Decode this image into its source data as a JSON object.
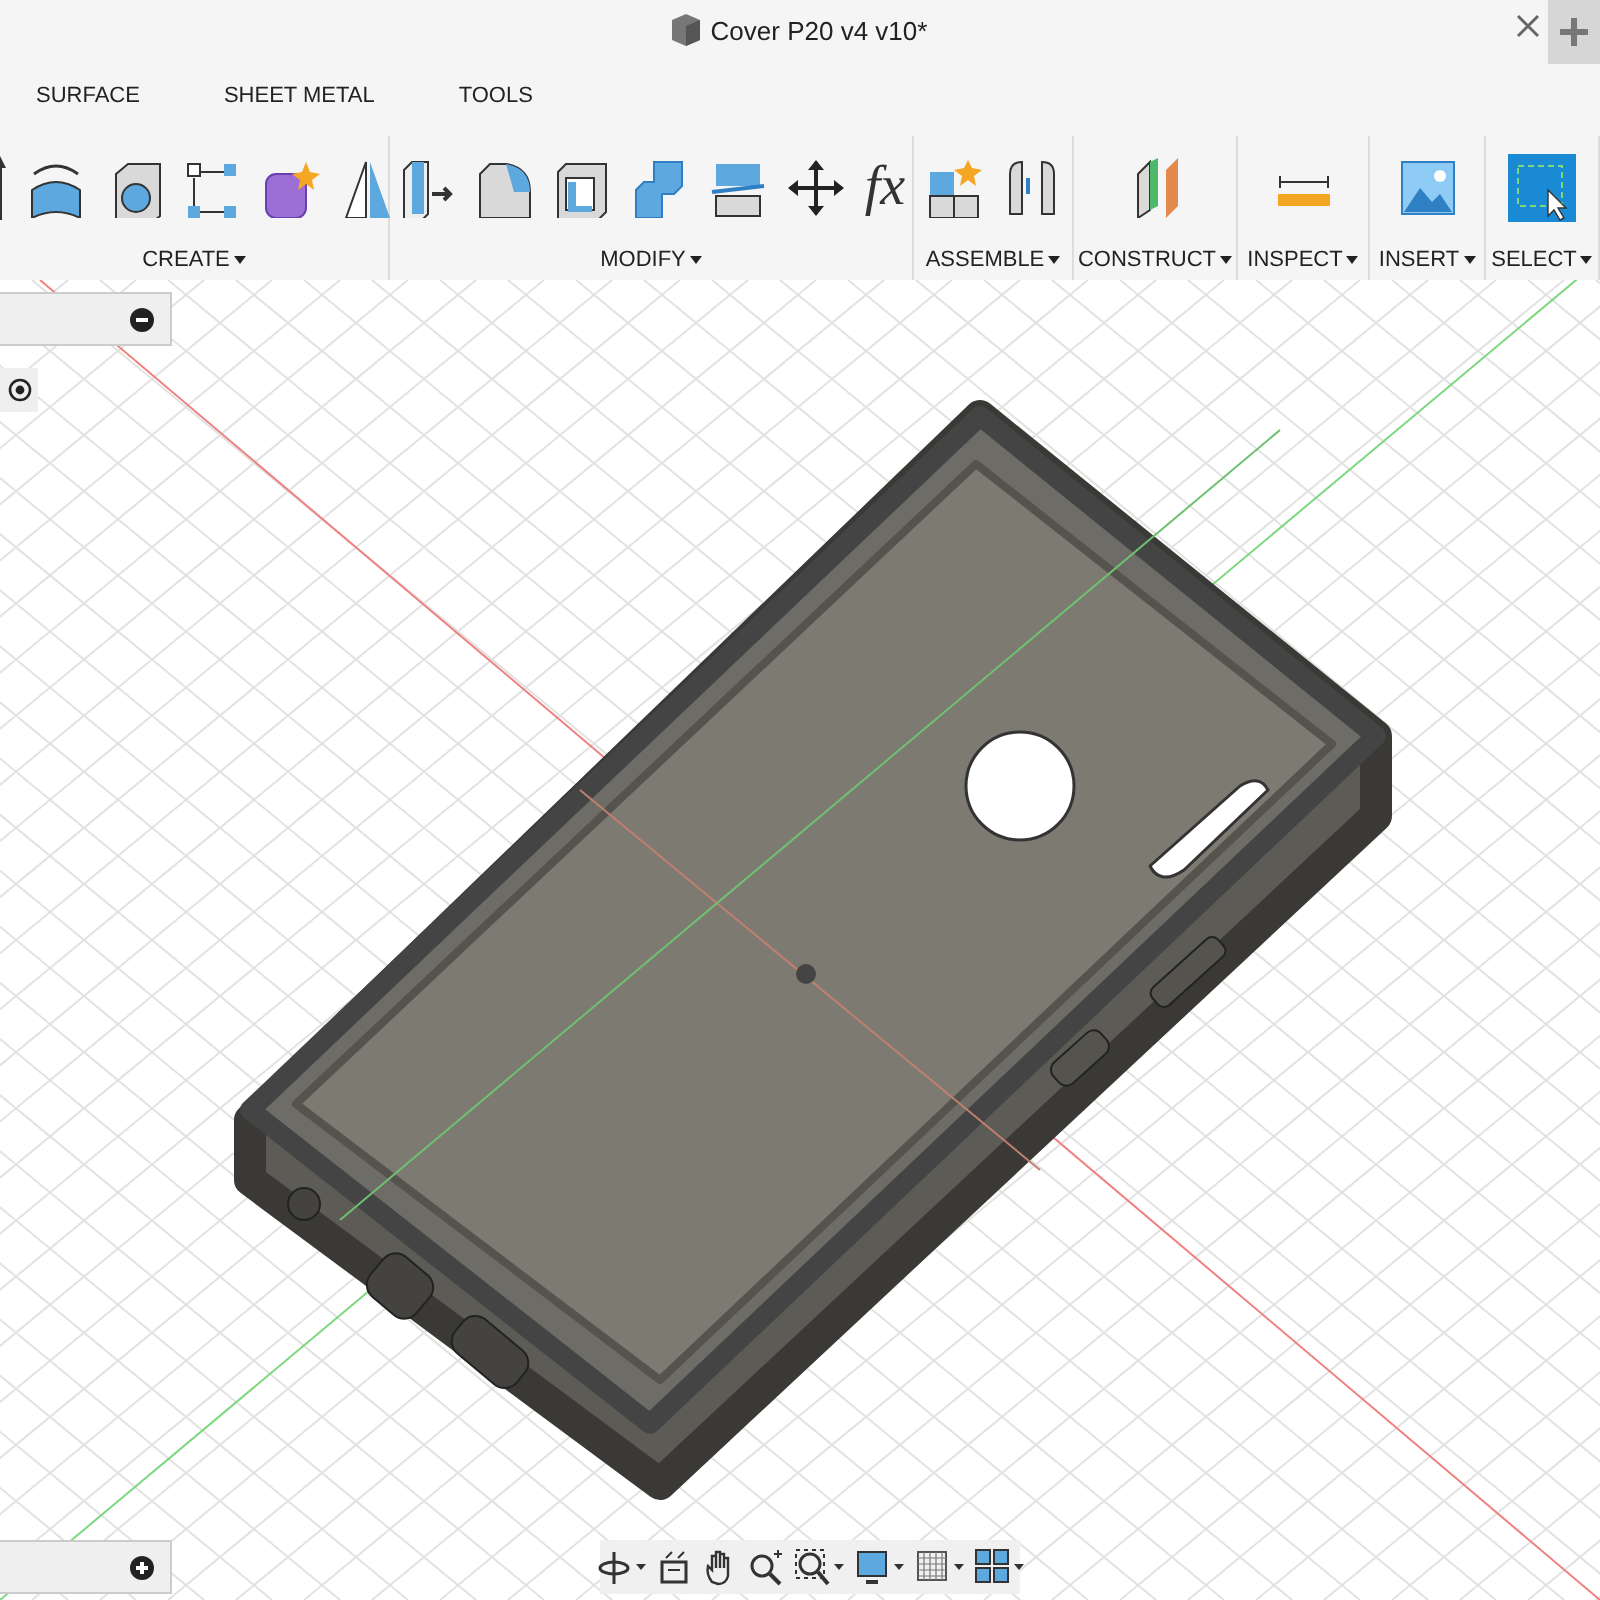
{
  "window": {
    "title": "Cover P20 v4 v10*"
  },
  "tabs": [
    {
      "label": "SURFACE",
      "selected": false
    },
    {
      "label": "SHEET METAL",
      "selected": false
    },
    {
      "label": "TOOLS",
      "selected": false
    }
  ],
  "toolbar_groups": [
    {
      "label": "CREATE"
    },
    {
      "label": "MODIFY",
      "symbol": "fx"
    },
    {
      "label": "ASSEMBLE"
    },
    {
      "label": "CONSTRUCT"
    },
    {
      "label": "INSPECT"
    },
    {
      "label": "INSERT"
    },
    {
      "label": "SELECT"
    }
  ]
}
